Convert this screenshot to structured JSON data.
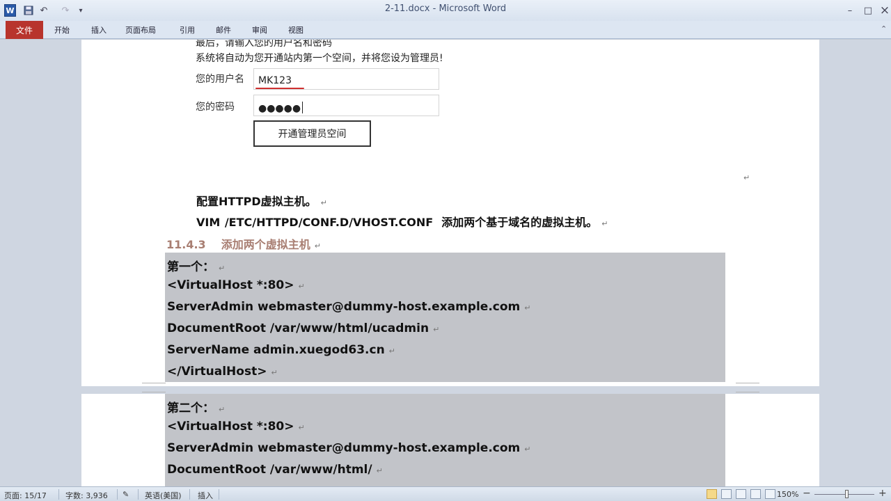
{
  "titlebar": {
    "app_icon": "W",
    "title": "2-11.docx - Microsoft Word",
    "icons": [
      "word-app-icon",
      "save-icon",
      "undo-icon",
      "redo-icon",
      "customize-toolbar-icon",
      "minimize-icon",
      "maximize-icon",
      "close-icon"
    ]
  },
  "ribbon": {
    "tabs": [
      "文件",
      "开始",
      "插入",
      "页面布局",
      "引用",
      "邮件",
      "审阅",
      "视图"
    ]
  },
  "doc": {
    "intro_line1": "最后，请输入您的用户名和密码",
    "intro_line2": "系统将自动为您开通站内第一个空间，并将您设为管理员!",
    "username_label": "您的用户名",
    "username_value": "MK123",
    "password_label": "您的密码",
    "password_value": "●●●●●",
    "submit_label": "开通管理员空间",
    "step1": "配置HTTPD虚拟主机。",
    "step2_cmd": "VIM    /ETC/HTTPD/CONF.D/VHOST.CONF",
    "step2_text": "添加两个基于域名的虚拟主机。",
    "heading_number": "11.4.3",
    "heading_text": "添加两个虚拟主机",
    "block1": [
      "第一个：",
      "<VirtualHost *:80>",
      "ServerAdmin webmaster@dummy-host.example.com",
      "DocumentRoot /var/www/html/ucadmin",
      "ServerName admin.xuegod63.cn",
      "</VirtualHost>"
    ],
    "block2": [
      "第二个：",
      "<VirtualHost *:80>",
      "ServerAdmin webmaster@dummy-host.example.com",
      "DocumentRoot /var/www/html/"
    ],
    "paragraph_mark": "↵"
  },
  "status": {
    "page": "页面: 15/17",
    "words": "字数: 3,936",
    "language": "英语(美国)",
    "mode": "插入",
    "zoom": "150%",
    "zoom_fraction": 0.55
  }
}
